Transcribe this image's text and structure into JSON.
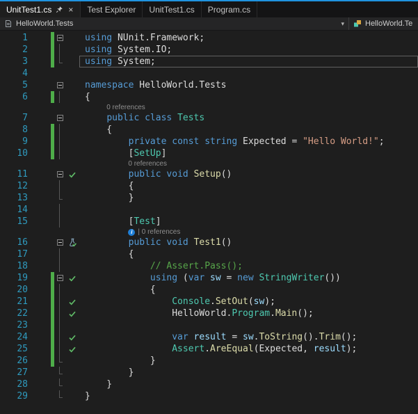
{
  "colors": {
    "accent": "#1f93e0",
    "keyword": "#569cd6",
    "type": "#4ec9b0",
    "method": "#dcdcaa",
    "string": "#d69d85",
    "comment": "#57a64a",
    "text": "#dcdcdc",
    "variable": "#9cdcfe",
    "line_number": "#2f9bbf",
    "change_bar": "#4ead49",
    "test_pass": "#5fba67"
  },
  "tabs": [
    {
      "label": "UnitTest1.cs",
      "active": true,
      "pinned": true,
      "closable": true
    },
    {
      "label": "Test Explorer"
    },
    {
      "label": "UnitTest1.cs"
    },
    {
      "label": "Program.cs"
    }
  ],
  "navbar": {
    "project_label": "HelloWorld.Tests",
    "type_label": "HelloWorld.Te"
  },
  "editor": {
    "lines": [
      {
        "n": 1,
        "fold": "box",
        "chg": true,
        "tokens": [
          [
            "kw",
            "using"
          ],
          [
            "pl",
            " NUnit.Framework;"
          ]
        ]
      },
      {
        "n": 2,
        "fold": "line",
        "chg": true,
        "tokens": [
          [
            "kw",
            "using"
          ],
          [
            "pl",
            " System.IO;"
          ]
        ]
      },
      {
        "n": 3,
        "fold": "end",
        "chg": true,
        "cur": true,
        "tokens": [
          [
            "kw",
            "using"
          ],
          [
            "pl",
            " System;"
          ]
        ]
      },
      {
        "n": 4,
        "tokens": []
      },
      {
        "n": 5,
        "fold": "box",
        "tokens": [
          [
            "kw",
            "namespace"
          ],
          [
            "pl",
            " HelloWorld.Tests"
          ]
        ]
      },
      {
        "n": 6,
        "fold": "line",
        "chg": true,
        "tokens": [
          [
            "pl",
            "{"
          ]
        ]
      },
      {
        "n": 7,
        "fold": "box",
        "lens": "0 references",
        "lensIndent": 4,
        "tokens": [
          [
            "pl",
            "    "
          ],
          [
            "kw",
            "public"
          ],
          [
            "pl",
            " "
          ],
          [
            "kw",
            "class"
          ],
          [
            "pl",
            " "
          ],
          [
            "ty",
            "Tests"
          ]
        ]
      },
      {
        "n": 8,
        "fold": "line",
        "chg": true,
        "tokens": [
          [
            "pl",
            "    {"
          ]
        ]
      },
      {
        "n": 9,
        "fold": "line",
        "chg": true,
        "tokens": [
          [
            "pl",
            "        "
          ],
          [
            "kw",
            "private"
          ],
          [
            "pl",
            " "
          ],
          [
            "kw",
            "const"
          ],
          [
            "pl",
            " "
          ],
          [
            "kw",
            "string"
          ],
          [
            "pl",
            " Expected = "
          ],
          [
            "st",
            "\"Hello World!\""
          ],
          [
            "pl",
            ";"
          ]
        ]
      },
      {
        "n": 10,
        "fold": "line",
        "chg": true,
        "tokens": [
          [
            "pl",
            "        ["
          ],
          [
            "ty",
            "SetUp"
          ],
          [
            "pl",
            "]"
          ]
        ]
      },
      {
        "n": 11,
        "fold": "box",
        "chk": "pass",
        "lens": "0 references",
        "lensIndent": 8,
        "tokens": [
          [
            "pl",
            "        "
          ],
          [
            "kw",
            "public"
          ],
          [
            "pl",
            " "
          ],
          [
            "kw",
            "void"
          ],
          [
            "pl",
            " "
          ],
          [
            "me",
            "Setup"
          ],
          [
            "pl",
            "()"
          ]
        ]
      },
      {
        "n": 12,
        "fold": "line",
        "tokens": [
          [
            "pl",
            "        {"
          ]
        ]
      },
      {
        "n": 13,
        "fold": "end",
        "tokens": [
          [
            "pl",
            "        }"
          ]
        ]
      },
      {
        "n": 14,
        "fold": "line",
        "tokens": []
      },
      {
        "n": 15,
        "fold": "line",
        "tokens": [
          [
            "pl",
            "        ["
          ],
          [
            "ty",
            "Test"
          ],
          [
            "pl",
            "]"
          ]
        ]
      },
      {
        "n": 16,
        "fold": "box",
        "chk": "beaker",
        "lens": "| 0 references",
        "lensInfo": true,
        "lensIndent": 8,
        "tokens": [
          [
            "pl",
            "        "
          ],
          [
            "kw",
            "public"
          ],
          [
            "pl",
            " "
          ],
          [
            "kw",
            "void"
          ],
          [
            "pl",
            " "
          ],
          [
            "me",
            "Test1"
          ],
          [
            "pl",
            "()"
          ]
        ]
      },
      {
        "n": 17,
        "fold": "line",
        "tokens": [
          [
            "pl",
            "        {"
          ]
        ]
      },
      {
        "n": 18,
        "fold": "line",
        "tokens": [
          [
            "pl",
            "            "
          ],
          [
            "co",
            "// Assert.Pass();"
          ]
        ]
      },
      {
        "n": 19,
        "fold": "box",
        "chk": "pass",
        "chg": true,
        "tokens": [
          [
            "pl",
            "            "
          ],
          [
            "kw",
            "using"
          ],
          [
            "pl",
            " ("
          ],
          [
            "kw",
            "var"
          ],
          [
            "pl",
            " "
          ],
          [
            "va",
            "sw"
          ],
          [
            "pl",
            " = "
          ],
          [
            "kw",
            "new"
          ],
          [
            "pl",
            " "
          ],
          [
            "ty",
            "StringWriter"
          ],
          [
            "pl",
            "())"
          ]
        ]
      },
      {
        "n": 20,
        "fold": "line",
        "chg": true,
        "tokens": [
          [
            "pl",
            "            {"
          ]
        ]
      },
      {
        "n": 21,
        "fold": "line",
        "chk": "pass",
        "chg": true,
        "tokens": [
          [
            "pl",
            "                "
          ],
          [
            "ty",
            "Console"
          ],
          [
            "pl",
            "."
          ],
          [
            "me",
            "SetOut"
          ],
          [
            "pl",
            "("
          ],
          [
            "va",
            "sw"
          ],
          [
            "pl",
            ");"
          ]
        ]
      },
      {
        "n": 22,
        "fold": "line",
        "chk": "pass",
        "chg": true,
        "tokens": [
          [
            "pl",
            "                HelloWorld."
          ],
          [
            "ty",
            "Program"
          ],
          [
            "pl",
            "."
          ],
          [
            "me",
            "Main"
          ],
          [
            "pl",
            "();"
          ]
        ]
      },
      {
        "n": 23,
        "fold": "line",
        "chg": true,
        "tokens": []
      },
      {
        "n": 24,
        "fold": "line",
        "chk": "pass",
        "chg": true,
        "tokens": [
          [
            "pl",
            "                "
          ],
          [
            "kw",
            "var"
          ],
          [
            "pl",
            " "
          ],
          [
            "va",
            "result"
          ],
          [
            "pl",
            " = "
          ],
          [
            "va",
            "sw"
          ],
          [
            "pl",
            "."
          ],
          [
            "me",
            "ToString"
          ],
          [
            "pl",
            "()."
          ],
          [
            "me",
            "Trim"
          ],
          [
            "pl",
            "();"
          ]
        ]
      },
      {
        "n": 25,
        "fold": "line",
        "chk": "pass",
        "chg": true,
        "tokens": [
          [
            "pl",
            "                "
          ],
          [
            "ty",
            "Assert"
          ],
          [
            "pl",
            "."
          ],
          [
            "me",
            "AreEqual"
          ],
          [
            "pl",
            "(Expected, "
          ],
          [
            "va",
            "result"
          ],
          [
            "pl",
            ");"
          ]
        ]
      },
      {
        "n": 26,
        "fold": "end",
        "chg": true,
        "tokens": [
          [
            "pl",
            "            }"
          ]
        ]
      },
      {
        "n": 27,
        "fold": "end",
        "tokens": [
          [
            "pl",
            "        }"
          ]
        ]
      },
      {
        "n": 28,
        "fold": "end",
        "tokens": [
          [
            "pl",
            "    }"
          ]
        ]
      },
      {
        "n": 29,
        "fold": "end",
        "tokens": [
          [
            "pl",
            "}"
          ]
        ]
      }
    ]
  }
}
